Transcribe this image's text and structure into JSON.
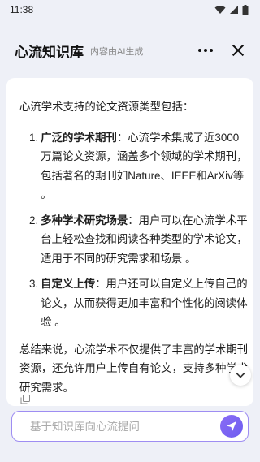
{
  "status_bar": {
    "time": "11:38"
  },
  "header": {
    "title": "心流知识库",
    "subtitle": "内容由AI生成"
  },
  "content": {
    "intro": "心流学术支持的论文资源类型包括：",
    "items": [
      {
        "number": "1.",
        "title": "广泛的学术期刊",
        "text": "：心流学术集成了近3000万篇论文资源，涵盖多个领域的学术期刊，包括著名的期刊如Nature、IEEE和ArXiv等 。"
      },
      {
        "number": "2.",
        "title": "多种学术研究场景",
        "text": "：用户可以在心流学术平台上轻松查找和阅读各种类型的学术论文，适用于不同的研究需求和场景 。"
      },
      {
        "number": "3.",
        "title": "自定义上传",
        "text": "：用户还可以自定义上传自己的论文，从而获得更加丰富和个性化的阅读体验 。"
      }
    ],
    "summary": "总结来说，心流学术不仅提供了丰富的学术期刊资源，还允许用户上传自有论文，支持多种学术研究需求。"
  },
  "input": {
    "placeholder": "基于知识库向心流提问"
  },
  "colors": {
    "accent": "#7b64f2",
    "input_border": "#9e8df2",
    "background": "#eef0f7"
  },
  "icons": {
    "signal": "wifi-icon",
    "cell": "cell-signal-icon",
    "battery": "battery-icon",
    "more": "more-icon",
    "close": "close-icon",
    "scroll": "chevron-down-icon",
    "copy": "copy-icon",
    "send": "send-icon"
  }
}
